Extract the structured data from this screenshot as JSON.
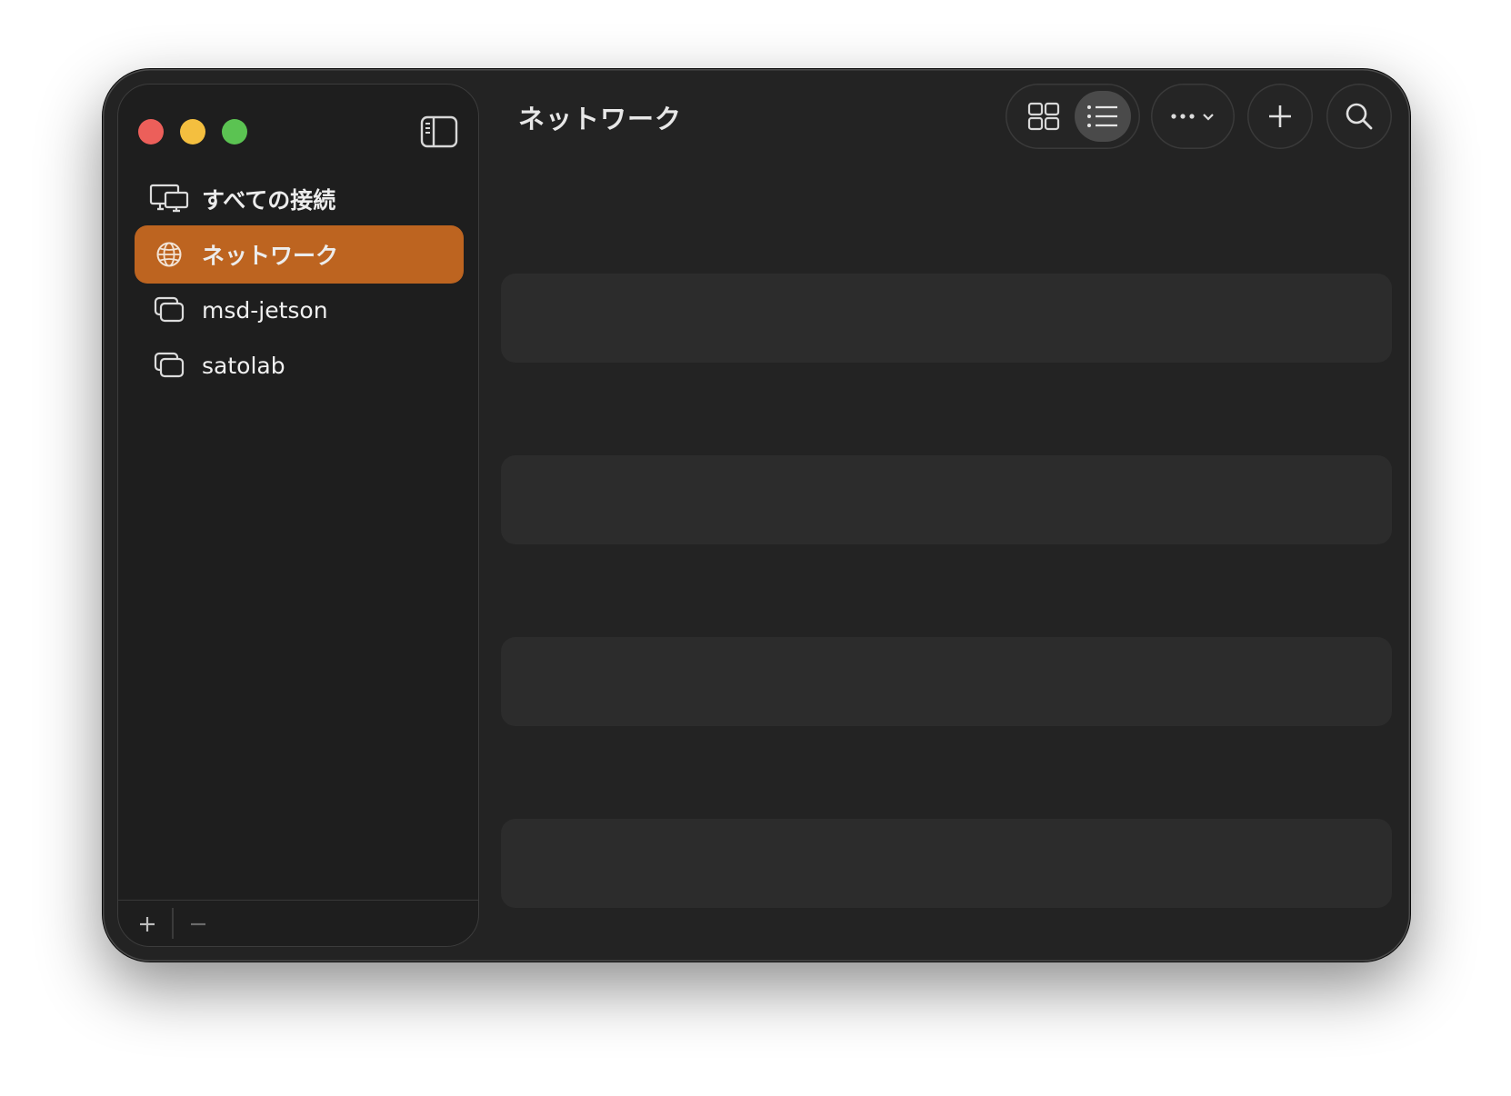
{
  "window": {
    "title": "ネットワーク"
  },
  "sidebar": {
    "items": [
      {
        "label": "すべての接続",
        "icon": "all-connections-icon",
        "selected": false
      },
      {
        "label": "ネットワーク",
        "icon": "globe-icon",
        "selected": true
      },
      {
        "label": "msd-jetson",
        "icon": "window-stack-icon",
        "selected": false
      },
      {
        "label": "satolab",
        "icon": "window-stack-icon",
        "selected": false
      }
    ],
    "footer": {
      "add": "+",
      "remove": "−"
    }
  },
  "toolbar": {
    "view_modes": [
      "grid-view",
      "list-view"
    ],
    "active_view": "list-view",
    "more_icon": "ellipsis-chevron-icon",
    "add_icon": "plus-icon",
    "search_icon": "magnifying-glass-icon"
  },
  "colors": {
    "accent": "#bd6420",
    "window_bg": "#232323",
    "sidebar_bg": "#1e1e1e",
    "row_bg": "#2c2c2c",
    "close": "#ec5f5a",
    "minimize": "#f4bf3f",
    "maximize": "#5bc352"
  },
  "content": {
    "rows": [
      "",
      "",
      "",
      ""
    ]
  }
}
